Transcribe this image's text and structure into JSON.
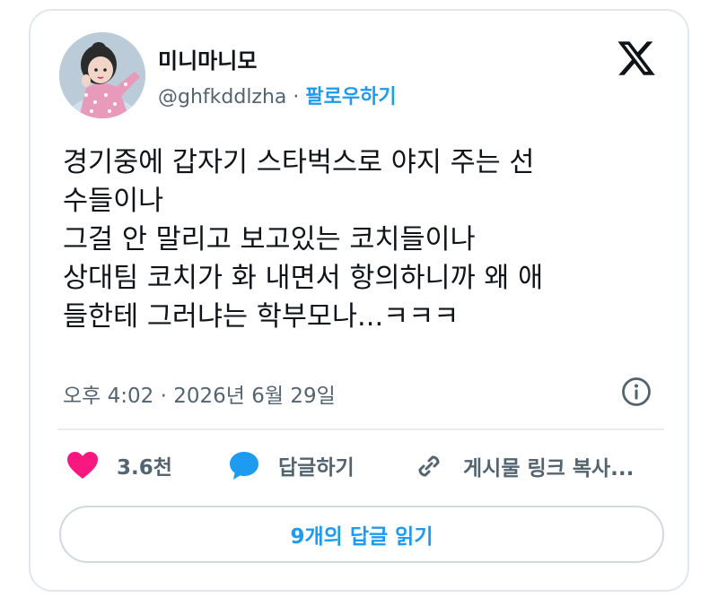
{
  "user": {
    "display_name": "미니마니모",
    "handle": "@ghfkddlzha",
    "separator": "·",
    "follow_label": "팔로우하기"
  },
  "tweet": {
    "lines": [
      "경기중에 갑자기 스타벅스로 야지 주는 선",
      "수들이나",
      "그걸 안 말리고 보고있는 코치들이나",
      "상대팀 코치가 화 내면서 항의하니까 왜 애",
      "들한테 그러냐는 학부모나...ㅋㅋㅋ"
    ],
    "timestamp": "오후 4:02 · 2026년 6월 29일"
  },
  "actions": {
    "like_count": "3.6천",
    "reply_label": "답글하기",
    "copy_link_label": "게시물 링크 복사..."
  },
  "replies_button": "9개의 답글 읽기",
  "icons": {
    "logo": "x-logo-icon",
    "info": "info-icon",
    "like": "heart-icon",
    "reply": "speech-bubble-icon",
    "link": "link-icon"
  },
  "colors": {
    "accent": "#1d9bf0",
    "heart": "#f91880",
    "secondary_text": "#536471",
    "border": "#e1e8ed"
  }
}
